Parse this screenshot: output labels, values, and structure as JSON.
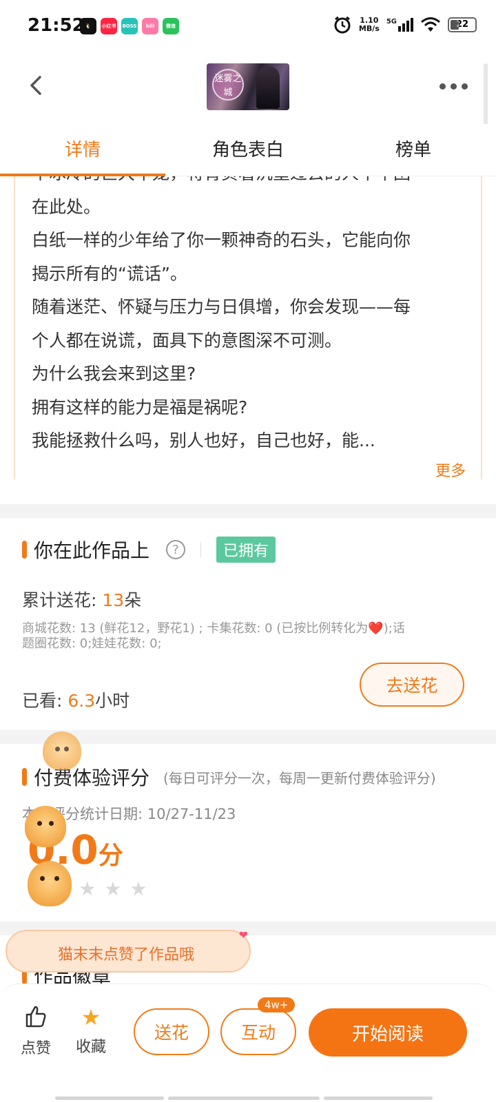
{
  "status_bar": {
    "time": "21:52",
    "apps": [
      {
        "label": "小红书",
        "color": "#ff2442"
      },
      {
        "label": "BOSS",
        "color": "#28c3b8"
      },
      {
        "label": "bili",
        "color": "#ff7aa6"
      },
      {
        "label": "微信",
        "color": "#2bc25c"
      }
    ],
    "net_speed": "1.10",
    "net_unit": "MB/s",
    "signal": "5G",
    "battery": "22"
  },
  "header": {
    "cover_title": "迷雾之城",
    "back_icon": "chevron-left-icon",
    "more_icon": "more-dots-icon"
  },
  "tabs": [
    {
      "label": "详情",
      "active": true
    },
    {
      "label": "角色表白",
      "active": false
    },
    {
      "label": "榜单",
      "active": false
    }
  ],
  "description": {
    "lines": [
      "个冰冷的巨大牢笼，将背负着沉重过去的人牢牢困",
      "在此处。",
      "白纸一样的少年给了你一颗神奇的石头，它能向你",
      "揭示所有的“谎话”。",
      "随着迷茫、怀疑与压力与日俱增，你会发现——每",
      "个人都在说谎，面具下的意图深不可测。",
      "为什么我会来到这里?",
      "拥有这样的能力是福是祸呢?",
      "我能拯救什么吗，别人也好，自己也好，能..."
    ],
    "more": "更多"
  },
  "ownership": {
    "title": "你在此作品上",
    "help": "?",
    "owned_badge": "已拥有",
    "flowers_label": "累计送花:",
    "flowers_value": "13",
    "flowers_unit": "朵",
    "flowers_detail_1": "商城花数: 13 (鲜花12，野花1) ; 卡集花数: 0 (已按比例转化为",
    "flowers_detail_heart": "❤️",
    "flowers_detail_2": ");话",
    "flowers_detail_3": "题圈花数: 0;娃娃花数: 0;",
    "watched_label": "已看:",
    "watched_value": "6.3",
    "watched_unit": "小时",
    "send_flowers_button": "去送花"
  },
  "rating": {
    "title": "付费体验评分",
    "subtitle": "(每日可评分一次，每周一更新付费体验评分)",
    "date_label": "本次评分统计日期:",
    "date_range": "10/27-11/23",
    "score": "0.0",
    "score_unit": "分",
    "stars": 0
  },
  "toast": {
    "text": "猫末末点赞了作品哦"
  },
  "next_section": {
    "title": "作品徽章"
  },
  "bottom_bar": {
    "like_label": "点赞",
    "favorite_label": "收藏",
    "flower_button": "送花",
    "interact_button": "互动",
    "interact_badge": "4w+",
    "read_button": "开始阅读"
  }
}
